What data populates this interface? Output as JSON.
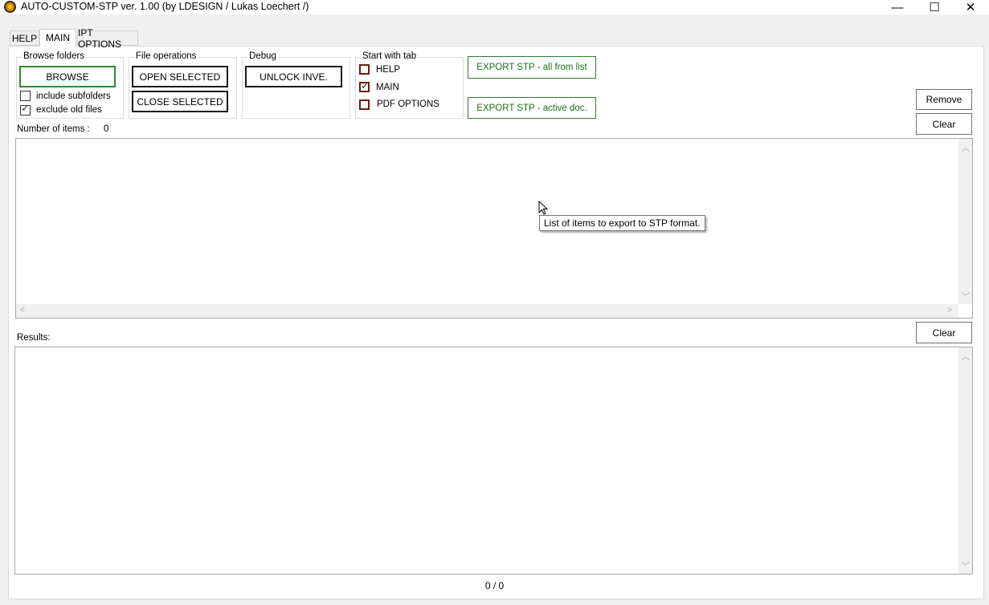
{
  "window": {
    "title": "AUTO-CUSTOM-STP ver. 1.00 (by LDESIGN / Lukas Loechert /)",
    "minimize_glyph": "—",
    "maximize_glyph": "☐",
    "close_glyph": "✕"
  },
  "tabs": [
    {
      "label": "HELP",
      "active": false
    },
    {
      "label": "MAIN",
      "active": true
    },
    {
      "label": "IPT OPTIONS",
      "active": false
    }
  ],
  "browse_folders": {
    "title": "Browse folders",
    "browse_label": "BROWSE",
    "include_subfolders": {
      "label": "include subfolders",
      "checked": false
    },
    "exclude_old_files": {
      "label": "exclude old files",
      "checked": true
    }
  },
  "file_operations": {
    "title": "File operations",
    "open_label": "OPEN SELECTED",
    "close_label": "CLOSE SELECTED"
  },
  "debug": {
    "title": "Debug",
    "unlock_label": "UNLOCK INVE."
  },
  "start_with_tab": {
    "title": "Start with tab",
    "options": [
      {
        "label": "HELP",
        "checked": false
      },
      {
        "label": "MAIN",
        "checked": true
      },
      {
        "label": "PDF OPTIONS",
        "checked": false
      }
    ]
  },
  "export": {
    "all_label": "EXPORT STP - all from list",
    "active_label": "EXPORT STP - active doc."
  },
  "list_actions": {
    "remove_label": "Remove",
    "clear_label": "Clear"
  },
  "items": {
    "count_label": "Number of items :",
    "count_value": "0",
    "tooltip": "List of items to export to STP format."
  },
  "results": {
    "label": "Results:",
    "clear_label": "Clear"
  },
  "progress": {
    "text": "0 / 0"
  },
  "colors": {
    "accent_green": "#2e8b2e",
    "checkbox_red": "#6b1a1a"
  }
}
